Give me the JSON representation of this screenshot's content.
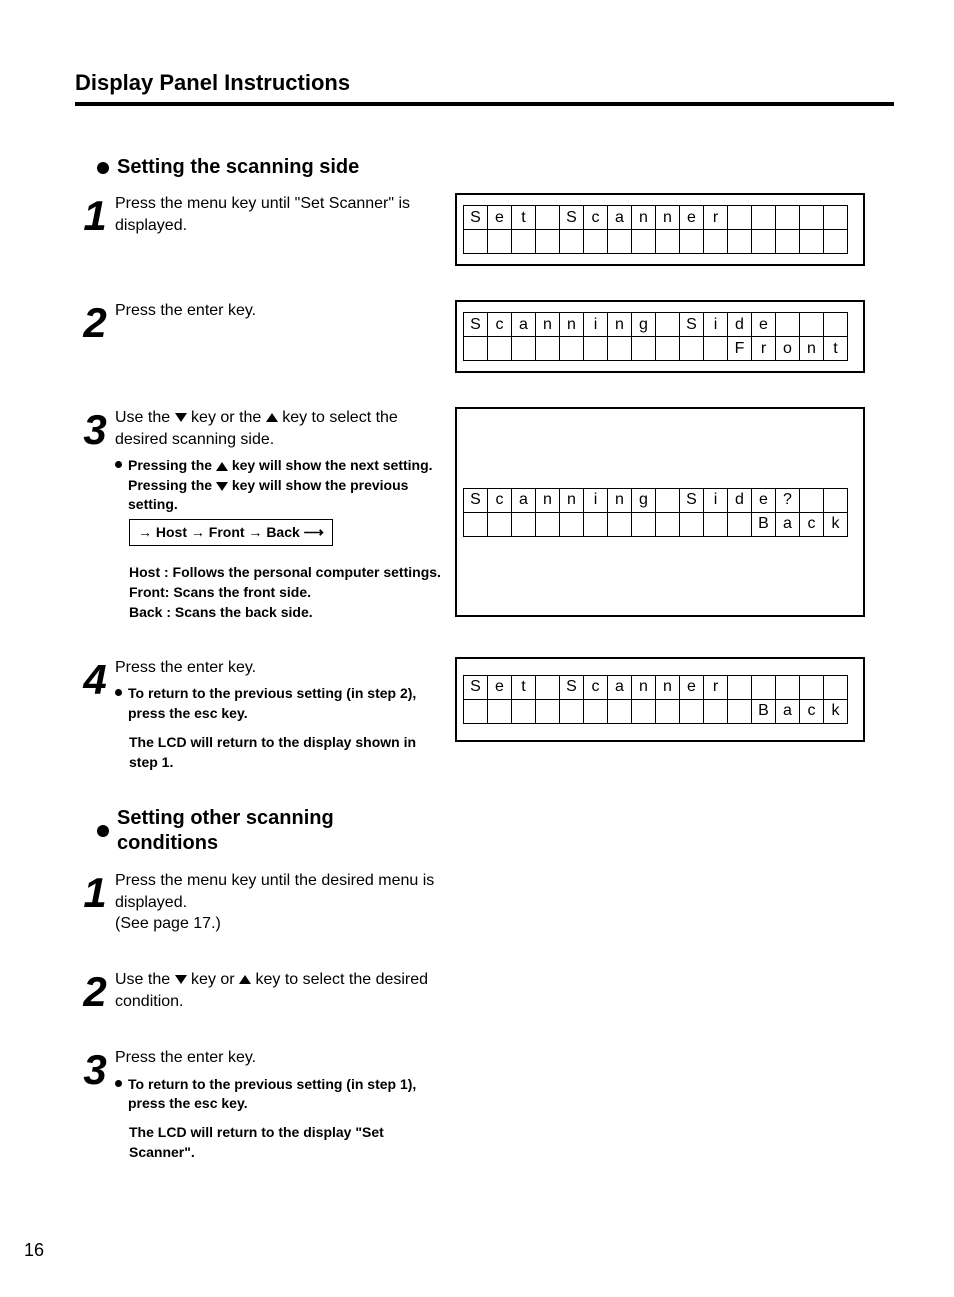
{
  "header": "Display Panel Instructions",
  "page_number": "16",
  "sectionA": {
    "title": "Setting the scanning side",
    "steps": [
      {
        "num": "1",
        "text": "Press the menu key until \"Set Scanner\" is displayed.",
        "lcd": {
          "line1": "Set Scanner     ",
          "line2": "                "
        }
      },
      {
        "num": "2",
        "text": "Press the enter key.",
        "lcd": {
          "line1": "Scanning Side   ",
          "line2": "           Front"
        }
      },
      {
        "num": "3",
        "text_a": "Use the ",
        "text_b": " key or the ",
        "text_c": " key to select the desired scanning side.",
        "sub_a": "Pressing the ",
        "sub_b": " key will show the next setting. Pressing the ",
        "sub_c": " key will show the previous setting.",
        "cycle": "→ Host → Front → Back ⟶",
        "defs_host": "Host : Follows the personal computer settings.",
        "defs_front": "Front: Scans the front side.",
        "defs_back": "Back : Scans the back side.",
        "lcd": {
          "line1": "Scanning Side?  ",
          "line2": "            Back"
        }
      },
      {
        "num": "4",
        "text": "Press the enter key.",
        "sub": "To return to the previous setting (in step 2), press the esc key.",
        "sub2": "The LCD will return to the display shown in step 1.",
        "lcd": {
          "line1": "Set Scanner     ",
          "line2": "            Back"
        }
      }
    ]
  },
  "sectionB": {
    "title": "Setting other scanning conditions",
    "steps": [
      {
        "num": "1",
        "text": "Press the menu key until the desired menu is displayed.",
        "text2": "(See page 17.)"
      },
      {
        "num": "2",
        "text_a": "Use the ",
        "text_b": " key or ",
        "text_c": " key to select the desired condition."
      },
      {
        "num": "3",
        "text": "Press the enter key.",
        "sub": "To return to the previous setting (in step 1), press the esc key.",
        "sub2": "The LCD will return to the display \"Set Scanner\"."
      }
    ]
  }
}
